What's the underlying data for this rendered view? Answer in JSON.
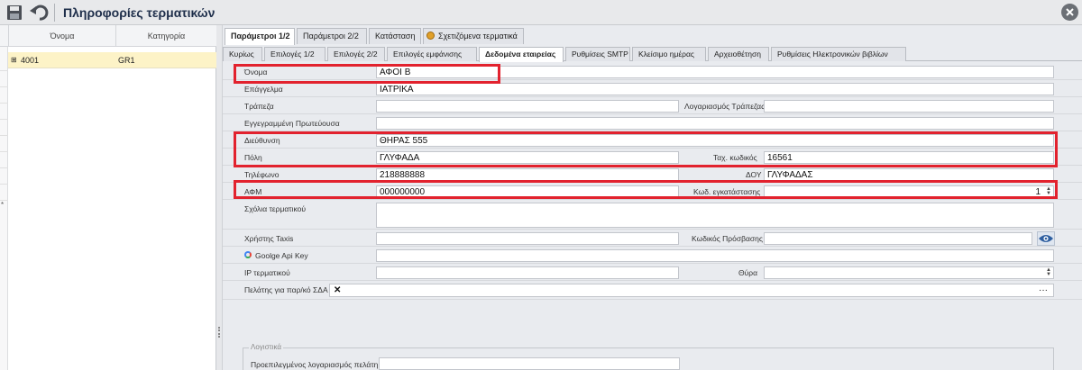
{
  "window": {
    "title": "Πληροφορίες τερματικών"
  },
  "grid": {
    "columns": [
      "Όνομα",
      "Κατηγορία"
    ],
    "rows": [
      {
        "name": "4001",
        "category": "GR1"
      }
    ]
  },
  "tabs_top": [
    {
      "label": "Παράμετροι 1/2",
      "active": true
    },
    {
      "label": "Παράμετροι 2/2",
      "active": false
    },
    {
      "label": "Κατάσταση",
      "active": false
    },
    {
      "label": "Σχετιζόμενα τερματικά",
      "active": false
    }
  ],
  "tabs_sub": [
    {
      "label": "Κυρίως",
      "active": false
    },
    {
      "label": "Επιλογές 1/2",
      "active": false
    },
    {
      "label": "Επιλογές 2/2",
      "active": false
    },
    {
      "label": "Επιλογές εμφάνισης",
      "active": false
    },
    {
      "label": "Δεδομένα εταιρείας",
      "active": true
    },
    {
      "label": "Ρυθμίσεις SMTP",
      "active": false
    },
    {
      "label": "Κλείσιμο ημέρας",
      "active": false
    },
    {
      "label": "Αρχειοθέτηση",
      "active": false
    },
    {
      "label": "Ρυθμίσεις Ηλεκτρονικών βιβλίων",
      "active": false
    }
  ],
  "form": {
    "name": {
      "label": "Όνομα",
      "value": "ΑΦΟΙ Β"
    },
    "profession": {
      "label": "Επάγγελμα",
      "value": "ΙΑΤΡΙΚΑ"
    },
    "bank": {
      "label": "Τράπεζα",
      "value": ""
    },
    "bank_account": {
      "label": "Λογαριασμός Τράπεζας",
      "value": ""
    },
    "registered_capital": {
      "label": "Εγγεγραμμένη Πρωτεύουσα",
      "value": ""
    },
    "address": {
      "label": "Διεύθυνση",
      "value": "ΘΗΡΑΣ 555"
    },
    "city": {
      "label": "Πόλη",
      "value": "ΓΛΥΦΑΔΑ"
    },
    "postal_code": {
      "label": "Ταχ. κωδικός",
      "value": "16561"
    },
    "phone": {
      "label": "Τηλέφωνο",
      "value": "218888888"
    },
    "tax_office": {
      "label": "ΔΟΥ",
      "value": "ΓΛΥΦΑΔΑΣ"
    },
    "afm": {
      "label": "ΑΦΜ",
      "value": "000000000"
    },
    "installation_code": {
      "label": "Κωδ. εγκατάστασης",
      "value": "1"
    },
    "terminal_comments": {
      "label": "Σχόλια τερματικού",
      "value": ""
    },
    "taxis_user": {
      "label": "Χρήστης Taxis",
      "value": ""
    },
    "access_code": {
      "label": "Κωδικός Πρόσβασης",
      "value": ""
    },
    "google_api_key": {
      "label": "Goolge Api Key",
      "value": ""
    },
    "terminal_ip": {
      "label": "IP τερματικού",
      "value": ""
    },
    "port": {
      "label": "Θύρα",
      "value": ""
    },
    "customer_sda": {
      "label": "Πελάτης για παρ/κό ΣΔΑ",
      "value": ""
    },
    "accounting": {
      "group_title": "Λογιστικά",
      "default_account": {
        "label": "Προεπιλεγμένος λογαριασμός πελάτη",
        "value": ""
      }
    }
  },
  "icons": {
    "save": "save-icon",
    "undo": "undo-icon",
    "close": "close-icon",
    "eye": "eye-icon",
    "google": "google-icon",
    "related": "related-terminals-icon"
  },
  "colors": {
    "highlight": "#e2222e",
    "selected_row": "#fdf3c7",
    "title": "#1e2e4a"
  }
}
